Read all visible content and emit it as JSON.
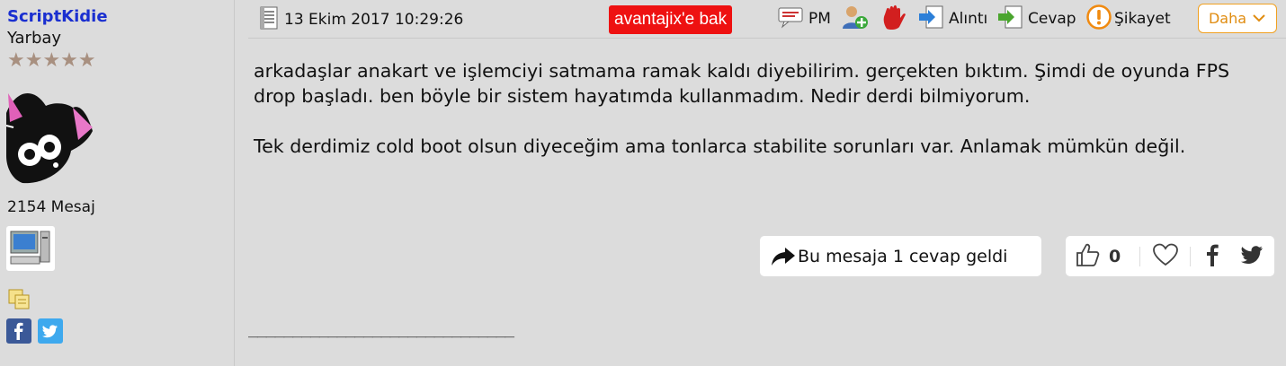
{
  "user": {
    "username": "ScriptKidie",
    "rank": "Yarbay",
    "stars": "★★★★★",
    "message_count": "2154 Mesaj"
  },
  "header": {
    "date": "13 Ekim 2017 10:29:26",
    "ad_label": "avantajix'e bak",
    "pm_label": "PM",
    "quote_label": "Alıntı",
    "reply_label": "Cevap",
    "complaint_label": "Şikayet",
    "more_label": "Daha"
  },
  "post": {
    "paragraphs": [
      "arkadaşlar anakart ve işlemciyi satmama ramak kaldı diyebilirim. gerçekten bıktım. Şimdi de oyunda FPS drop başladı. ben böyle bir sistem hayatımda kullanmadım. Nedir derdi bilmiyorum.",
      "Tek derdimiz cold boot olsun diyeceğim ama tonlarca stabilite sorunları var. Anlamak mümkün değil."
    ]
  },
  "footer": {
    "reply_notice": "Bu mesaja 1 cevap geldi",
    "like_count": "0",
    "signature_line": "______________________________"
  },
  "colors": {
    "background": "#dcdcdc",
    "username": "#1a2fd0",
    "ad_badge": "#ee1111",
    "more_border": "#f0a020"
  }
}
